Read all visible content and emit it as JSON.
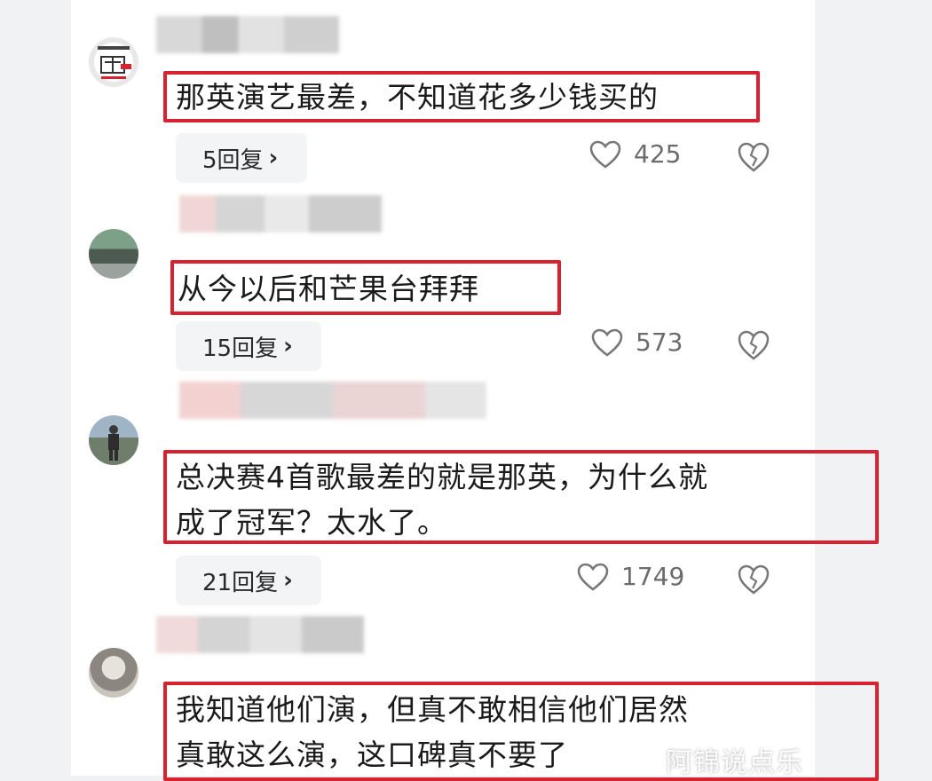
{
  "comments": [
    {
      "text_lines": [
        "那英演艺最差，不知道花多少钱买的"
      ],
      "replies_label": "5回复",
      "likes": "425"
    },
    {
      "text_lines": [
        "从今以后和芒果台拜拜"
      ],
      "replies_label": "15回复",
      "likes": "573"
    },
    {
      "text_lines": [
        "总决赛4首歌最差的就是那英，为什么就",
        "成了冠军？太水了。"
      ],
      "replies_label": "21回复",
      "likes": "1749"
    },
    {
      "text_lines": [
        "我知道他们演，但真不敢相信他们居然",
        "真敢这么演，这口碑真不要了"
      ]
    }
  ],
  "icons": {
    "like": "heart-outline-icon",
    "dislike": "broken-heart-icon",
    "reply_chevron": "chevron-right-icon"
  },
  "watermark": "阿锦说点乐",
  "colors": {
    "highlight_border": "#d6232f",
    "background": "#f1f2f4",
    "card": "#ffffff"
  }
}
